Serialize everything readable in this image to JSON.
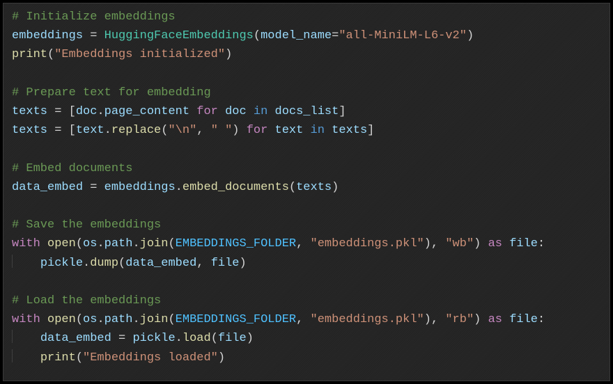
{
  "code": {
    "lines": [
      {
        "type": "comment",
        "tokens": [
          {
            "cls": "c",
            "t": "# Initialize embeddings"
          }
        ]
      },
      {
        "type": "code",
        "tokens": [
          {
            "cls": "id",
            "t": "embeddings"
          },
          {
            "cls": "op",
            "t": " = "
          },
          {
            "cls": "cls",
            "t": "HuggingFaceEmbeddings"
          },
          {
            "cls": "op",
            "t": "("
          },
          {
            "cls": "id",
            "t": "model_name"
          },
          {
            "cls": "op",
            "t": "="
          },
          {
            "cls": "str",
            "t": "\"all-MiniLM-L6-v2\""
          },
          {
            "cls": "op",
            "t": ")"
          }
        ]
      },
      {
        "type": "code",
        "tokens": [
          {
            "cls": "fn",
            "t": "print"
          },
          {
            "cls": "op",
            "t": "("
          },
          {
            "cls": "str",
            "t": "\"Embeddings initialized\""
          },
          {
            "cls": "op",
            "t": ")"
          }
        ]
      },
      {
        "type": "blank"
      },
      {
        "type": "comment",
        "tokens": [
          {
            "cls": "c",
            "t": "# Prepare text for embedding"
          }
        ]
      },
      {
        "type": "code",
        "tokens": [
          {
            "cls": "id",
            "t": "texts"
          },
          {
            "cls": "op",
            "t": " = ["
          },
          {
            "cls": "id",
            "t": "doc"
          },
          {
            "cls": "op",
            "t": "."
          },
          {
            "cls": "id",
            "t": "page_content"
          },
          {
            "cls": "op",
            "t": " "
          },
          {
            "cls": "kw",
            "t": "for"
          },
          {
            "cls": "op",
            "t": " "
          },
          {
            "cls": "id",
            "t": "doc"
          },
          {
            "cls": "op",
            "t": " "
          },
          {
            "cls": "kw2",
            "t": "in"
          },
          {
            "cls": "op",
            "t": " "
          },
          {
            "cls": "id",
            "t": "docs_list"
          },
          {
            "cls": "op",
            "t": "]"
          }
        ]
      },
      {
        "type": "code",
        "tokens": [
          {
            "cls": "id",
            "t": "texts"
          },
          {
            "cls": "op",
            "t": " = ["
          },
          {
            "cls": "id",
            "t": "text"
          },
          {
            "cls": "op",
            "t": "."
          },
          {
            "cls": "fn",
            "t": "replace"
          },
          {
            "cls": "op",
            "t": "("
          },
          {
            "cls": "str",
            "t": "\"\\n\""
          },
          {
            "cls": "op",
            "t": ", "
          },
          {
            "cls": "str",
            "t": "\" \""
          },
          {
            "cls": "op",
            "t": ") "
          },
          {
            "cls": "kw",
            "t": "for"
          },
          {
            "cls": "op",
            "t": " "
          },
          {
            "cls": "id",
            "t": "text"
          },
          {
            "cls": "op",
            "t": " "
          },
          {
            "cls": "kw2",
            "t": "in"
          },
          {
            "cls": "op",
            "t": " "
          },
          {
            "cls": "id",
            "t": "texts"
          },
          {
            "cls": "op",
            "t": "]"
          }
        ]
      },
      {
        "type": "blank"
      },
      {
        "type": "comment",
        "tokens": [
          {
            "cls": "c",
            "t": "# Embed documents"
          }
        ]
      },
      {
        "type": "code",
        "tokens": [
          {
            "cls": "id",
            "t": "data_embed"
          },
          {
            "cls": "op",
            "t": " = "
          },
          {
            "cls": "id",
            "t": "embeddings"
          },
          {
            "cls": "op",
            "t": "."
          },
          {
            "cls": "fn",
            "t": "embed_documents"
          },
          {
            "cls": "op",
            "t": "("
          },
          {
            "cls": "id",
            "t": "texts"
          },
          {
            "cls": "op",
            "t": ")"
          }
        ]
      },
      {
        "type": "blank"
      },
      {
        "type": "comment",
        "tokens": [
          {
            "cls": "c",
            "t": "# Save the embeddings"
          }
        ]
      },
      {
        "type": "code",
        "tokens": [
          {
            "cls": "kw",
            "t": "with"
          },
          {
            "cls": "op",
            "t": " "
          },
          {
            "cls": "fn",
            "t": "open"
          },
          {
            "cls": "op",
            "t": "("
          },
          {
            "cls": "id",
            "t": "os"
          },
          {
            "cls": "op",
            "t": "."
          },
          {
            "cls": "id",
            "t": "path"
          },
          {
            "cls": "op",
            "t": "."
          },
          {
            "cls": "fn",
            "t": "join"
          },
          {
            "cls": "op",
            "t": "("
          },
          {
            "cls": "con",
            "t": "EMBEDDINGS_FOLDER"
          },
          {
            "cls": "op",
            "t": ", "
          },
          {
            "cls": "str",
            "t": "\"embeddings.pkl\""
          },
          {
            "cls": "op",
            "t": "), "
          },
          {
            "cls": "str",
            "t": "\"wb\""
          },
          {
            "cls": "op",
            "t": ") "
          },
          {
            "cls": "kw",
            "t": "as"
          },
          {
            "cls": "op",
            "t": " "
          },
          {
            "cls": "id",
            "t": "file"
          },
          {
            "cls": "op",
            "t": ":"
          }
        ]
      },
      {
        "type": "code",
        "indent": 1,
        "tokens": [
          {
            "cls": "id",
            "t": "pickle"
          },
          {
            "cls": "op",
            "t": "."
          },
          {
            "cls": "fn",
            "t": "dump"
          },
          {
            "cls": "op",
            "t": "("
          },
          {
            "cls": "id",
            "t": "data_embed"
          },
          {
            "cls": "op",
            "t": ", "
          },
          {
            "cls": "id",
            "t": "file"
          },
          {
            "cls": "op",
            "t": ")"
          }
        ]
      },
      {
        "type": "blank"
      },
      {
        "type": "comment",
        "tokens": [
          {
            "cls": "c",
            "t": "# Load the embeddings"
          }
        ]
      },
      {
        "type": "code",
        "tokens": [
          {
            "cls": "kw",
            "t": "with"
          },
          {
            "cls": "op",
            "t": " "
          },
          {
            "cls": "fn",
            "t": "open"
          },
          {
            "cls": "op",
            "t": "("
          },
          {
            "cls": "id",
            "t": "os"
          },
          {
            "cls": "op",
            "t": "."
          },
          {
            "cls": "id",
            "t": "path"
          },
          {
            "cls": "op",
            "t": "."
          },
          {
            "cls": "fn",
            "t": "join"
          },
          {
            "cls": "op",
            "t": "("
          },
          {
            "cls": "con",
            "t": "EMBEDDINGS_FOLDER"
          },
          {
            "cls": "op",
            "t": ", "
          },
          {
            "cls": "str",
            "t": "\"embeddings.pkl\""
          },
          {
            "cls": "op",
            "t": "), "
          },
          {
            "cls": "str",
            "t": "\"rb\""
          },
          {
            "cls": "op",
            "t": ") "
          },
          {
            "cls": "kw",
            "t": "as"
          },
          {
            "cls": "op",
            "t": " "
          },
          {
            "cls": "id",
            "t": "file"
          },
          {
            "cls": "op",
            "t": ":"
          }
        ]
      },
      {
        "type": "code",
        "indent": 1,
        "tokens": [
          {
            "cls": "id",
            "t": "data_embed"
          },
          {
            "cls": "op",
            "t": " = "
          },
          {
            "cls": "id",
            "t": "pickle"
          },
          {
            "cls": "op",
            "t": "."
          },
          {
            "cls": "fn",
            "t": "load"
          },
          {
            "cls": "op",
            "t": "("
          },
          {
            "cls": "id",
            "t": "file"
          },
          {
            "cls": "op",
            "t": ")"
          }
        ]
      },
      {
        "type": "code",
        "indent": 1,
        "tokens": [
          {
            "cls": "fn",
            "t": "print"
          },
          {
            "cls": "op",
            "t": "("
          },
          {
            "cls": "str",
            "t": "\"Embeddings loaded\""
          },
          {
            "cls": "op",
            "t": ")"
          }
        ]
      }
    ]
  }
}
